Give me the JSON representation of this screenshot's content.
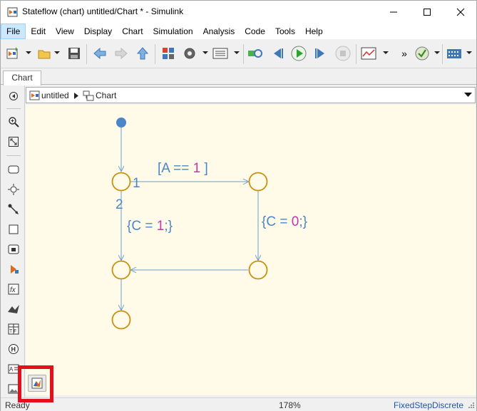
{
  "window": {
    "title": "Stateflow (chart) untitled/Chart * - Simulink",
    "controls": [
      "minimize",
      "maximize",
      "close"
    ]
  },
  "menubar": {
    "items": [
      "File",
      "Edit",
      "View",
      "Display",
      "Chart",
      "Simulation",
      "Analysis",
      "Code",
      "Tools",
      "Help"
    ],
    "active": "File"
  },
  "toolbar": {
    "overflow_label": "»",
    "icons": [
      "new-model-icon",
      "open-folder-icon",
      "save-icon",
      "back-arrow-icon",
      "forward-arrow-icon",
      "up-arrow-icon",
      "library-browser-icon",
      "model-settings-icon",
      "model-explorer-icon",
      "build-icon",
      "step-back-icon",
      "run-icon",
      "step-forward-icon",
      "stop-icon",
      "scope-icon",
      "check-icon",
      "signal-table-icon"
    ]
  },
  "tabs": [
    {
      "label": "Chart"
    }
  ],
  "breadcrumb": {
    "items": [
      "untitled",
      "Chart"
    ]
  },
  "palette": {
    "tools": [
      "collapse-palette-icon",
      "zoom-in-icon",
      "fit-view-icon",
      "state-tool-icon",
      "junction-tool-icon",
      "default-transition-icon",
      "box-tool-icon",
      "simulink-function-icon",
      "subcharted-state-icon",
      "graphical-function-icon",
      "matlab-function-icon",
      "truth-table-icon",
      "history-junction-icon",
      "annotation-icon",
      "image-icon"
    ]
  },
  "chart": {
    "transition_labels": {
      "condition_a": "[A == ",
      "condition_a_value": "1",
      "condition_a_close": " ]",
      "action_c1_open": "{C = ",
      "action_c1_value": "1",
      "action_c1_close": ";}",
      "action_c0_open": "{C = ",
      "action_c0_value": "0",
      "action_c0_close": ";}",
      "order_1": "1",
      "order_2": "2"
    },
    "colors": {
      "background": "#fffbe8",
      "junction_stroke": "#c8900f",
      "transition_line": "#6a9fd4",
      "label_text": "#4a86c8",
      "value_text": "#c038b0",
      "default_dot": "#4a86c8"
    }
  },
  "status": {
    "left": "Ready",
    "zoom": "178%",
    "solver": "FixedStepDiscrete"
  },
  "hide_show_button": {
    "icon": "matlab-logo-icon"
  }
}
